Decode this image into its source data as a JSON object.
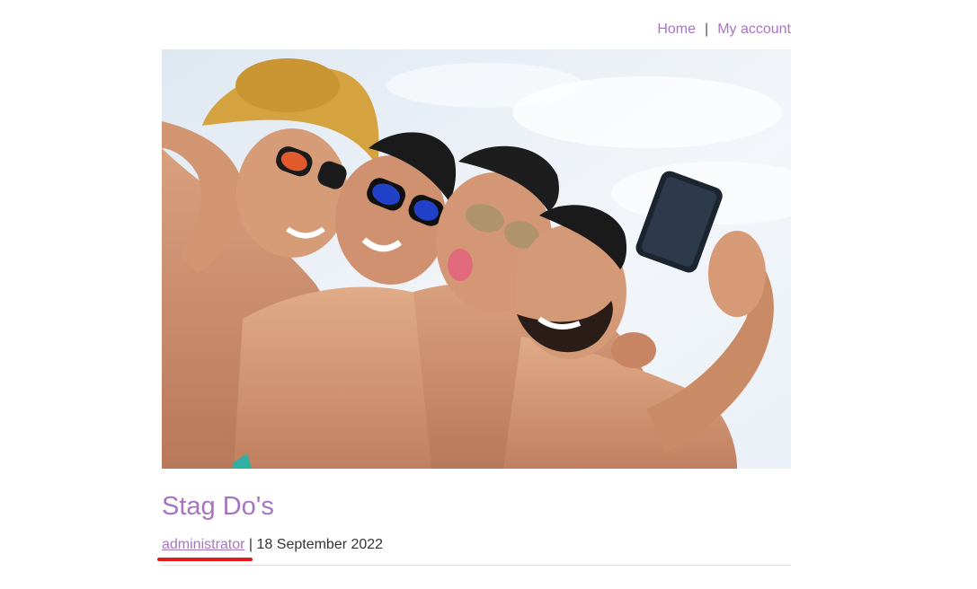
{
  "nav": {
    "home_label": "Home",
    "separator": "|",
    "account_label": "My account"
  },
  "post": {
    "image_alt": "Four shirtless men taking a selfie at the beach",
    "title": "Stag Do's",
    "author": "administrator",
    "meta_separator": " | ",
    "date": "18 September 2022"
  },
  "colors": {
    "link": "#a774c2",
    "annotation": "#e01b1b",
    "divider": "#dddddd"
  }
}
